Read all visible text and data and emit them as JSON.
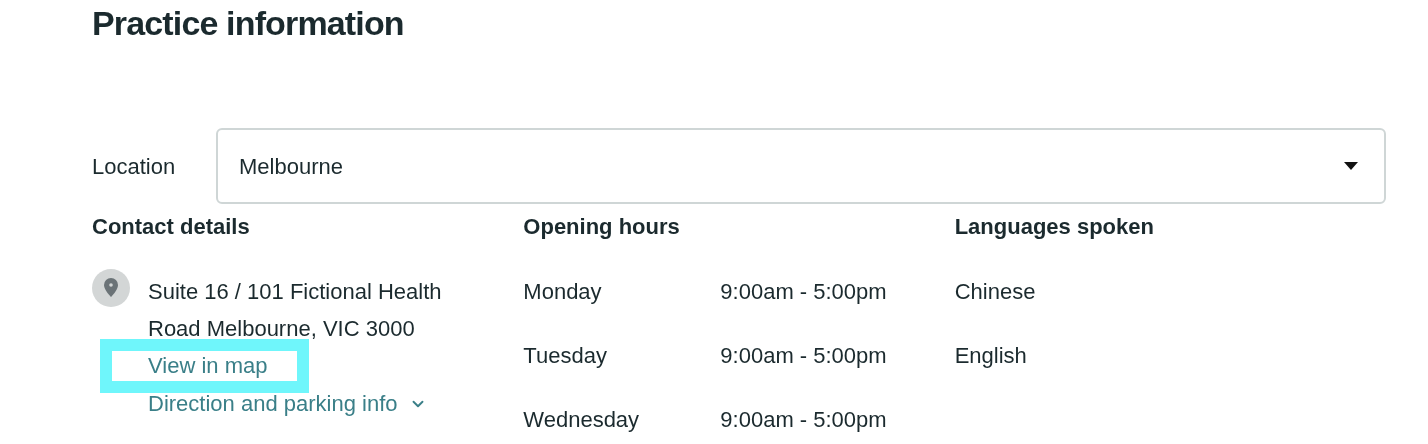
{
  "title": "Practice information",
  "location": {
    "label": "Location",
    "value": "Melbourne"
  },
  "contact": {
    "heading": "Contact details",
    "address": "Suite 16 / 101 Fictional Health Road Melbourne, VIC 3000",
    "links": [
      {
        "kind": "link",
        "label": "View in map",
        "highlighted": true
      },
      {
        "kind": "expander",
        "label": "Direction and parking info",
        "highlighted": false
      }
    ]
  },
  "hours": {
    "heading": "Opening hours",
    "rows": [
      {
        "day": "Monday",
        "time": "9:00am - 5:00pm"
      },
      {
        "day": "Tuesday",
        "time": "9:00am - 5:00pm"
      },
      {
        "day": "Wednesday",
        "time": "9:00am - 5:00pm"
      }
    ]
  },
  "languages": {
    "heading": "Languages spoken",
    "items": [
      "Chinese",
      "English"
    ]
  }
}
